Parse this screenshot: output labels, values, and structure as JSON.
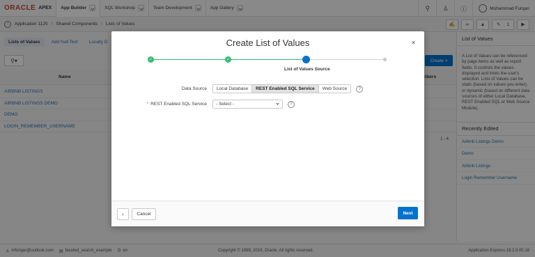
{
  "topbar": {
    "brand": "ORACLE",
    "product": "APEX",
    "nav": [
      "App Builder",
      "SQL Workshop",
      "Team Development",
      "App Gallery"
    ],
    "user": "Muhammad Furqan"
  },
  "breadcrumb": {
    "items": [
      "Application 1125",
      "Shared Components",
      "Lists of Values"
    ],
    "counter": "1"
  },
  "tabs": [
    "Lists of Values",
    "Add Null Text",
    "Locally D"
  ],
  "toolbar": {
    "create_label": "Create"
  },
  "table": {
    "header_name": "Name",
    "header_subscribers": "ribers",
    "rows": [
      "AIRBNB LISTINGS",
      "AIRBNB LISTINGS DEMO",
      "DEMO",
      "LOGIN_REMEMBER_USERNAME"
    ],
    "pager": "1 - 4"
  },
  "right_panel": {
    "title": "List of Values",
    "description": "A List of Values can be referenced by page items as well as report fields. It controls the values displayed and limits the user's selection. Lists of Values can be static (based on values you enter), or dynamic (based on different data sources of either Local Database, REST Enabled SQL or Web Source Module).",
    "recent_title": "Recently Edited",
    "recent_items": [
      "Airbnb Listings Demo",
      "Demo",
      "Airbnb Listings",
      "Login Remember Username"
    ]
  },
  "footer": {
    "email": "mfurqan@outlook.com",
    "workspace": "faceted_search_example",
    "language": "en",
    "copyright": "Copyright © 1999, 2019, Oracle. All rights reserved.",
    "version": "Application Express 19.2.0.00.18"
  },
  "dialog": {
    "title": "Create List of Values",
    "close": "×",
    "wizard_current_label": "List of Values Source",
    "data_source_label": "Data Source",
    "data_source_options": [
      "Local Database",
      "REST Enabled SQL Service",
      "Web Source"
    ],
    "rest_label": "REST Enabled SQL Service",
    "rest_value": "- Select -",
    "cancel_label": "Cancel",
    "next_label": "Next"
  },
  "colors": {
    "primary": "#0572ce",
    "success": "#2ebf6b",
    "brand": "#c74634"
  }
}
